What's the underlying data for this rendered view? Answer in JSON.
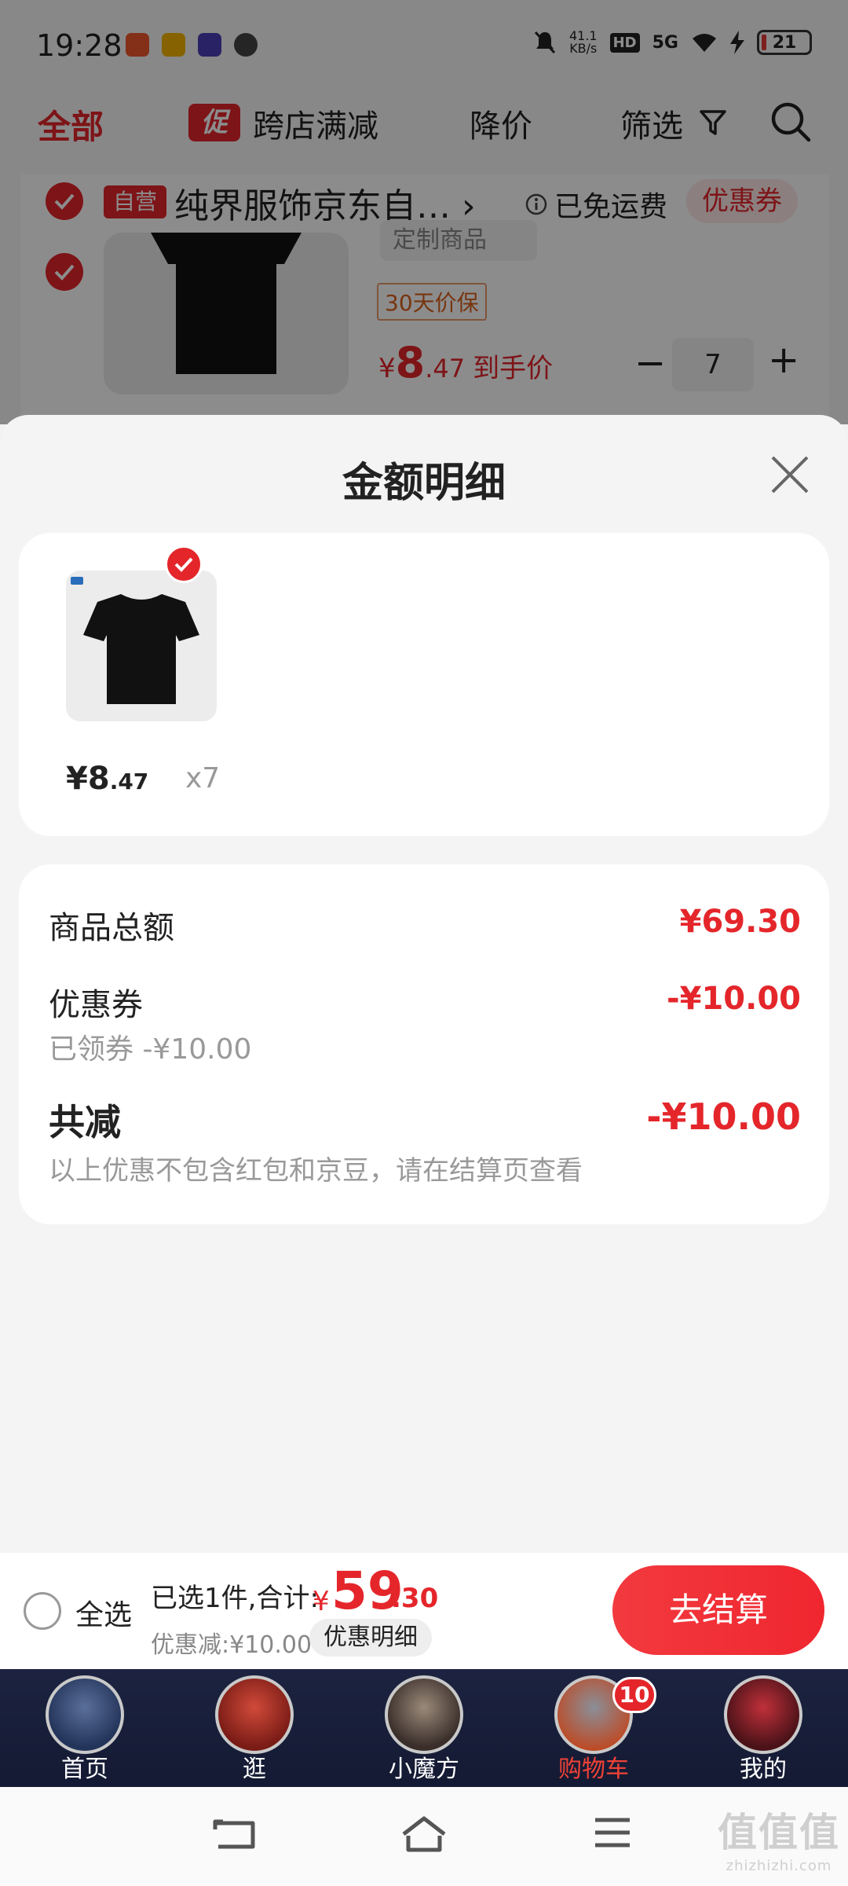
{
  "status_bar": {
    "time": "19:28",
    "net_speed": "41.1",
    "net_unit": "KB/s",
    "hd": "HD",
    "signal": "5G",
    "battery": "21"
  },
  "filter_bar": {
    "all": "全部",
    "promo_badge": "促",
    "cross_store": "跨店满减",
    "price_drop": "降价",
    "filter": "筛选"
  },
  "shop": {
    "self_badge": "自营",
    "name": "纯界服饰京东自…",
    "chevron": "›",
    "shipping": "已免运费",
    "coupon": "优惠券"
  },
  "product_bg": {
    "spec": "定制商品",
    "guarantee": "30天价保",
    "price_symbol": "¥",
    "price_int": "8",
    "price_dec": ".47",
    "price_label": "到手价",
    "qty_minus": "−",
    "qty": "7",
    "qty_plus": "+"
  },
  "sheet": {
    "title": "金额明细",
    "item": {
      "price_symbol": "¥",
      "price_int": "8",
      "price_dec": ".47",
      "qty": "x7"
    },
    "summary": {
      "goods_total_label": "商品总额",
      "goods_total_value": "¥69.30",
      "coupon_label": "优惠券",
      "coupon_value": "-¥10.00",
      "coupon_sub": "已领券 -¥10.00",
      "total_off_label": "共减",
      "total_off_value": "-¥10.00",
      "note": "以上优惠不包含红包和京豆，请在结算页查看"
    }
  },
  "checkout": {
    "select_all": "全选",
    "selected_text": "已选1件,合计:",
    "total_symbol": "¥",
    "total_int": "59",
    "total_dec": ".30",
    "discount_text": "优惠减:¥10.00",
    "detail_button": "优惠明细",
    "checkout_button": "去结算"
  },
  "tabs": [
    {
      "label": "首页",
      "icon": "captain-avatar-icon"
    },
    {
      "label": "逛",
      "icon": "ironman-avatar-icon"
    },
    {
      "label": "小魔方",
      "icon": "thor-avatar-icon"
    },
    {
      "label": "购物车",
      "icon": "warmachine-avatar-icon",
      "active": true,
      "badge": "10"
    },
    {
      "label": "我的",
      "icon": "antman-avatar-icon"
    }
  ],
  "watermark": {
    "text": "值值值",
    "url": "zhizhizhi.com"
  },
  "colors": {
    "accent": "#e4262b",
    "tab_bar": "#1c2340"
  }
}
